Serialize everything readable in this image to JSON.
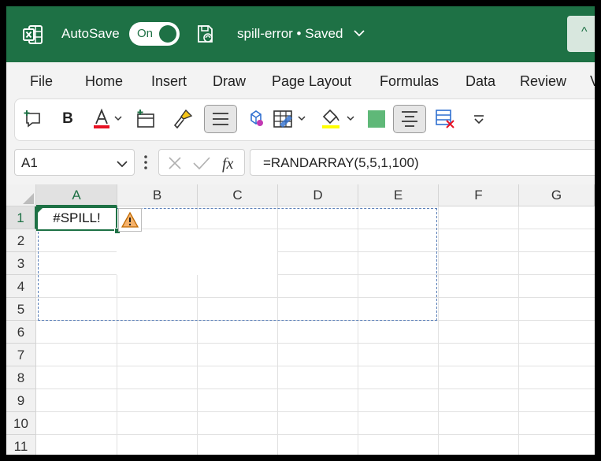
{
  "titlebar": {
    "autosave_label": "AutoSave",
    "autosave_toggle": "On",
    "doc_title": "spill-error • Saved",
    "brand_color": "#1e7145"
  },
  "menu": [
    "File",
    "Home",
    "Insert",
    "Draw",
    "Page Layout",
    "Formulas",
    "Data",
    "Review",
    "V"
  ],
  "ribbon": {
    "bold_label": "B",
    "font_color": "#e81123",
    "highlight_color": "#ffff00",
    "fill_swatch": "#5fb878",
    "icons": [
      "comment-add-icon",
      "bold-icon",
      "font-color-icon",
      "insert-table-icon",
      "format-painter-icon",
      "align-icon",
      "shapes-icon",
      "table-format-icon",
      "highlight-icon",
      "fill-color-icon",
      "center-align-icon",
      "clear-format-icon",
      "overflow-chevron-icon"
    ]
  },
  "formula_bar": {
    "name_box": "A1",
    "formula": "=RANDARRAY(5,5,1,100)"
  },
  "grid": {
    "columns": [
      "A",
      "B",
      "C",
      "D",
      "E",
      "F",
      "G"
    ],
    "rows": [
      "1",
      "2",
      "3",
      "4",
      "5",
      "6",
      "7",
      "8",
      "9",
      "10",
      "11"
    ],
    "active_cell_value": "#SPILL!"
  }
}
